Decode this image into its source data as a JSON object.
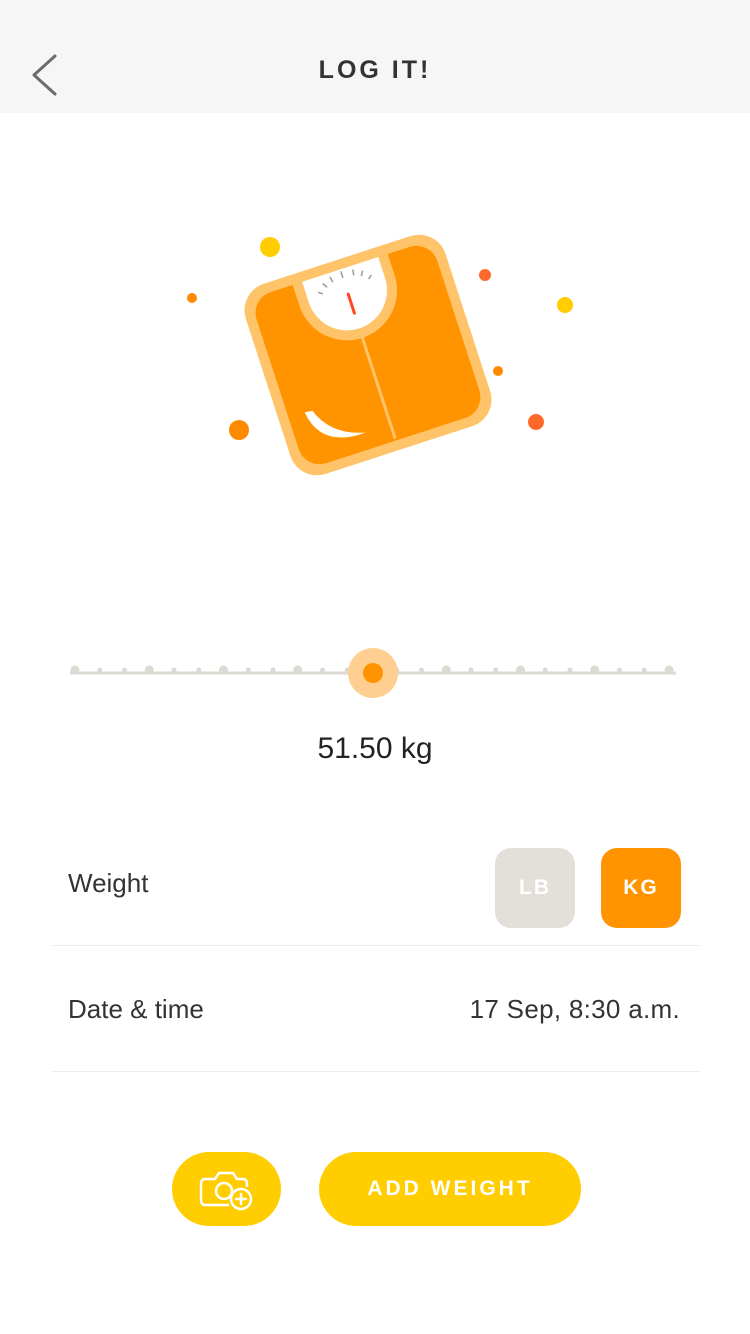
{
  "header": {
    "title": "LOG IT!",
    "back_icon": "chevron-left-icon"
  },
  "illustration": {
    "icon": "bathroom-scale-icon"
  },
  "slider": {
    "position_fraction": 0.5
  },
  "weight": {
    "readout": "51.50 kg",
    "label": "Weight",
    "units": [
      {
        "label": "LB",
        "selected": false
      },
      {
        "label": "KG",
        "selected": true
      }
    ]
  },
  "date_time": {
    "label": "Date & time",
    "value": "17 Sep, 8:30 a.m."
  },
  "actions": {
    "camera_icon": "camera-add-icon",
    "add_label": "ADD WEIGHT"
  },
  "colors": {
    "header_bg": "#f6f6f6",
    "accent_orange": "#ff9400",
    "accent_yellow": "#ffcd00",
    "unit_inactive": "#e3e0da",
    "slider_track": "#ddd9d3"
  }
}
